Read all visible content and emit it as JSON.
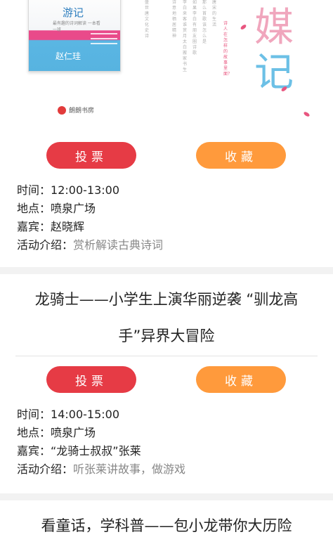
{
  "banner": {
    "book_title": "游记",
    "book_subtitle": "最有趣的诗词解读 一本看一班",
    "book_author": "赵仁珪",
    "publisher": "朗朗书房",
    "vertical_texts": [
      "盛世唐文化史诗",
      "诗意地栖居精神",
      "李白来客谁赏月 太白搬家书生",
      "如果李白有朋友圈 诗歌",
      "那么首歌该怎么是",
      "唐宋的生活"
    ],
    "side_question": "诗人在怎样的故事里面？",
    "big_chars": [
      "媒",
      "记"
    ]
  },
  "events": [
    {
      "vote_label": "投票",
      "fav_label": "收藏",
      "time_label": "时间：",
      "time": "12:00-13:00",
      "place_label": "地点：",
      "place": "喷泉广场",
      "guest_label": "嘉宾：",
      "guest": "赵晓辉",
      "intro_label": "活动介绍：",
      "intro": "赏析解读古典诗词"
    },
    {
      "title_line1": "龙骑士——小学生上演华丽逆袭 “驯龙高",
      "title_line2": "手”异界大冒险",
      "vote_label": "投票",
      "fav_label": "收藏",
      "time_label": "时间：",
      "time": "14:00-15:00",
      "place_label": "地点：",
      "place": "喷泉广场",
      "guest_label": "嘉宾：",
      "guest": "“龙骑士叔叔”张莱",
      "intro_label": "活动介绍：",
      "intro": "听张莱讲故事，做游戏"
    },
    {
      "title_line1": "看童话，学科普——包小龙带你大历险"
    }
  ],
  "colors": {
    "vote": "#e63b45",
    "favorite": "#ff9a3c",
    "divider": "#f2f2f2",
    "intro_text": "#888888"
  }
}
